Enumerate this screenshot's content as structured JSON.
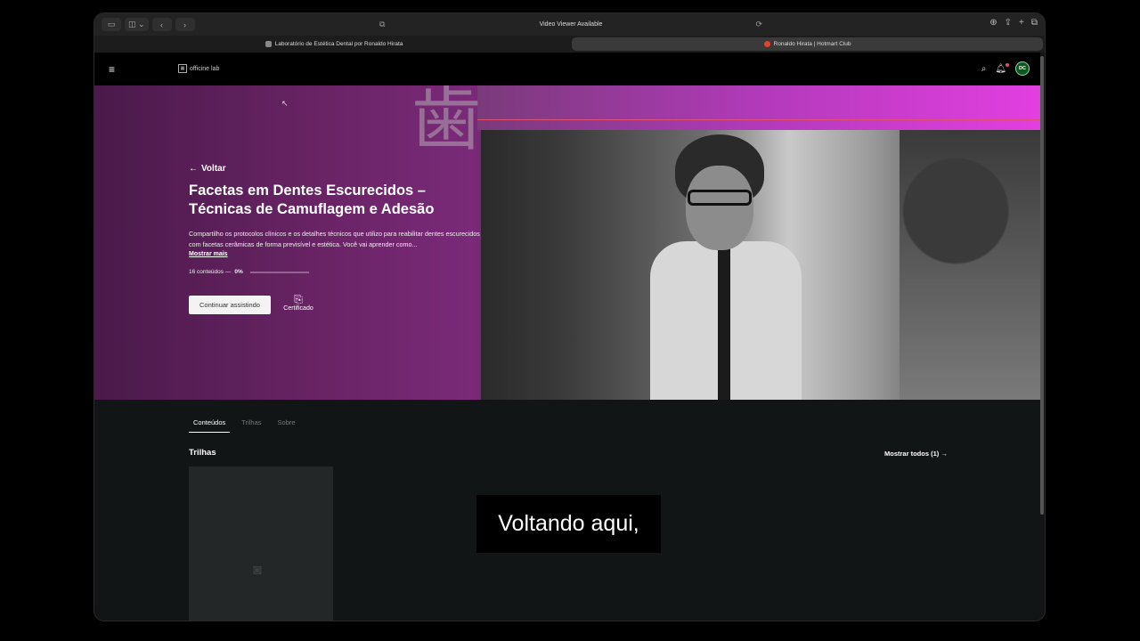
{
  "browser": {
    "address_title": "Video Viewer Available",
    "tabs": [
      {
        "label": "Laboratório de Estética Dental por Ronaldo Hirata",
        "active": false
      },
      {
        "label": "Ronaldo Hirata | Hotmart Club",
        "active": true
      }
    ]
  },
  "nav": {
    "logo_text": "officine lab",
    "avatar_initials": "DC"
  },
  "hero": {
    "back_label": "Voltar",
    "title": "Facetas em Dentes Escurecidos – Técnicas de Camuflagem e Adesão",
    "description": "Compartilho os protocolos clínicos e os detalhes técnicos que utilizo para reabilitar dentes escurecidos com facetas cerâmicas de forma previsível e estética. Você vai aprender como...",
    "show_more": "Mostrar mais",
    "contents_count": "16 conteúdos —",
    "progress_label": "0%",
    "progress": 0,
    "continue_label": "Continuar assistindo",
    "certificate_label": "Certificado"
  },
  "content_tabs": [
    {
      "label": "Conteúdos",
      "active": true
    },
    {
      "label": "Trilhas",
      "active": false
    },
    {
      "label": "Sobre",
      "active": false
    }
  ],
  "trilhas": {
    "title": "Trilhas",
    "show_all": "Mostrar todos (1) →"
  },
  "caption": {
    "text": "Voltando aqui,"
  },
  "colors": {
    "accent_magenta": "#e23fe0",
    "hero_purple": "#6a2466",
    "avatar_ring": "#7edc9e"
  }
}
